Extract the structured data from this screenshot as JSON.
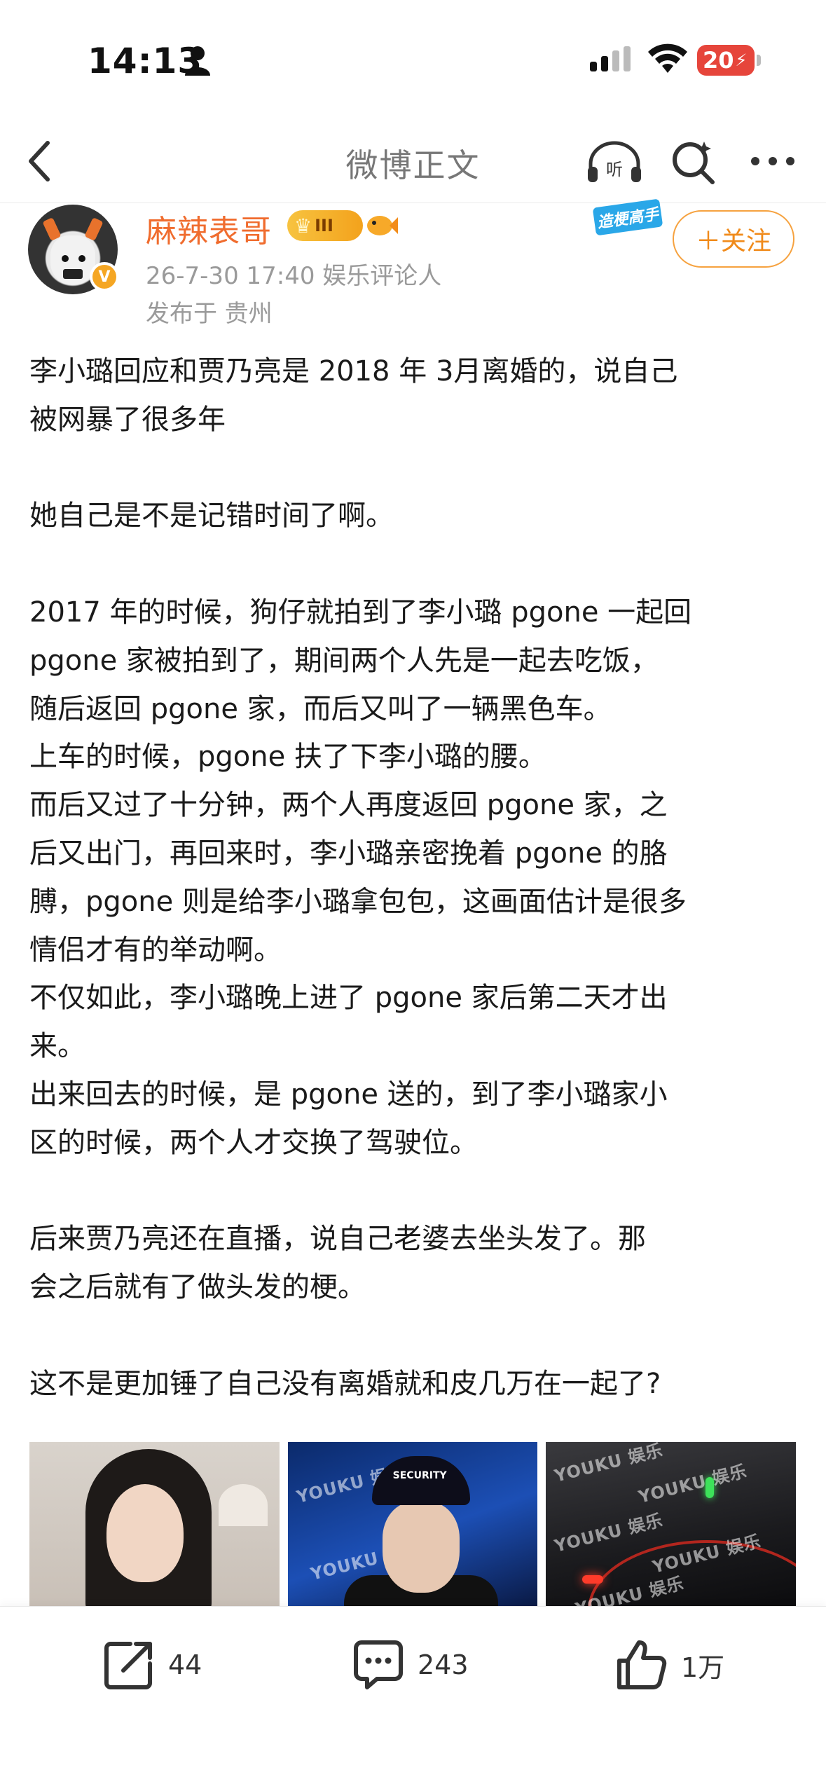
{
  "status_bar": {
    "time": "14:13",
    "battery": "20"
  },
  "nav": {
    "title": "微博正文",
    "back_icon": "chevron-left-icon",
    "listen_icon": "headphones-icon",
    "search_icon": "search-icon",
    "more_icon": "more-icon"
  },
  "author": {
    "name": "麻辣表哥",
    "level": "III",
    "meta": "26-7-30 17:40  娱乐评论人",
    "location": "发布于 贵州",
    "expert_tag": "造梗高手",
    "follow_label": "＋关注",
    "verified": "V"
  },
  "post": {
    "paragraphs": [
      "李小璐回应和贾乃亮是 2018 年 3月离婚的，说自己\n被网暴了很多年",
      "",
      "她自己是不是记错时间了啊。",
      "",
      "2017 年的时候，狗仔就拍到了李小璐 pgone 一起回\npgone 家被拍到了，期间两个人先是一起去吃饭，\n随后返回 pgone 家，而后又叫了一辆黑色车。\n上车的时候，pgone 扶了下李小璐的腰。\n而后又过了十分钟，两个人再度返回 pgone 家，之\n后又出门，再回来时，李小璐亲密挽着 pgone 的胳\n膊，pgone 则是给李小璐拿包包，这画面估计是很多\n情侣才有的举动啊。\n不仅如此，李小璐晚上进了 pgone 家后第二天才出\n来。\n出来回去的时候，是 pgone 送的，到了李小璐家小\n区的时候，两个人才交换了驾驶位。",
      "",
      "后来贾乃亮还在直播，说自己老婆去坐头发了。那\n会之后就有了做头发的梗。",
      "",
      "这不是更加锤了自己没有离婚就和皮几万在一起了?"
    ]
  },
  "images": {
    "watermark": "YOUKU 娱乐",
    "security_text": "SECURITY"
  },
  "actions": {
    "repost_count": "44",
    "comment_count": "243",
    "like_count": "1万"
  },
  "colors": {
    "accent": "#f06c2e",
    "follow_border": "#f6a23f",
    "battery": "#e6453b",
    "muted": "#9a9a9a"
  }
}
